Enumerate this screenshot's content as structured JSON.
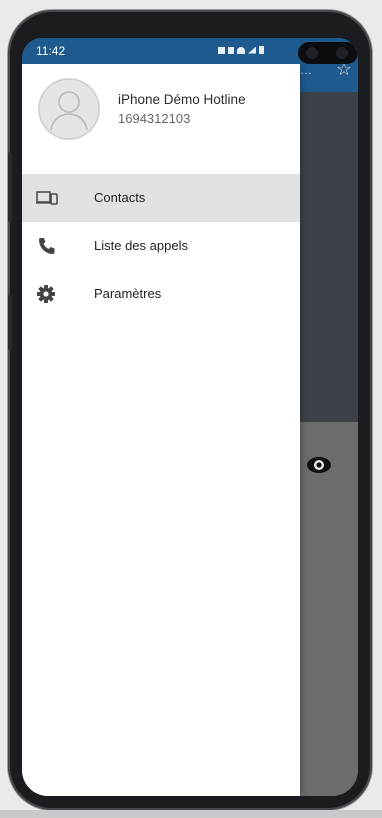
{
  "status_bar": {
    "time": "11:42"
  },
  "drawer": {
    "user": {
      "name": "iPhone Démo Hotline",
      "number": "1694312103"
    },
    "items": [
      {
        "label": "Contacts",
        "icon": "devices-icon",
        "active": true
      },
      {
        "label": "Liste des appels",
        "icon": "phone-icon",
        "active": false
      },
      {
        "label": "Paramètres",
        "icon": "gear-icon",
        "active": false
      }
    ]
  },
  "background_app": {
    "star_glyph": "☆",
    "overflow_glyph": "…"
  },
  "colors": {
    "app_bar": "#1e5a8e",
    "drawer_bg": "#ffffff",
    "active_item_bg": "#e1e1e1",
    "scrim": "#6e6f71"
  }
}
